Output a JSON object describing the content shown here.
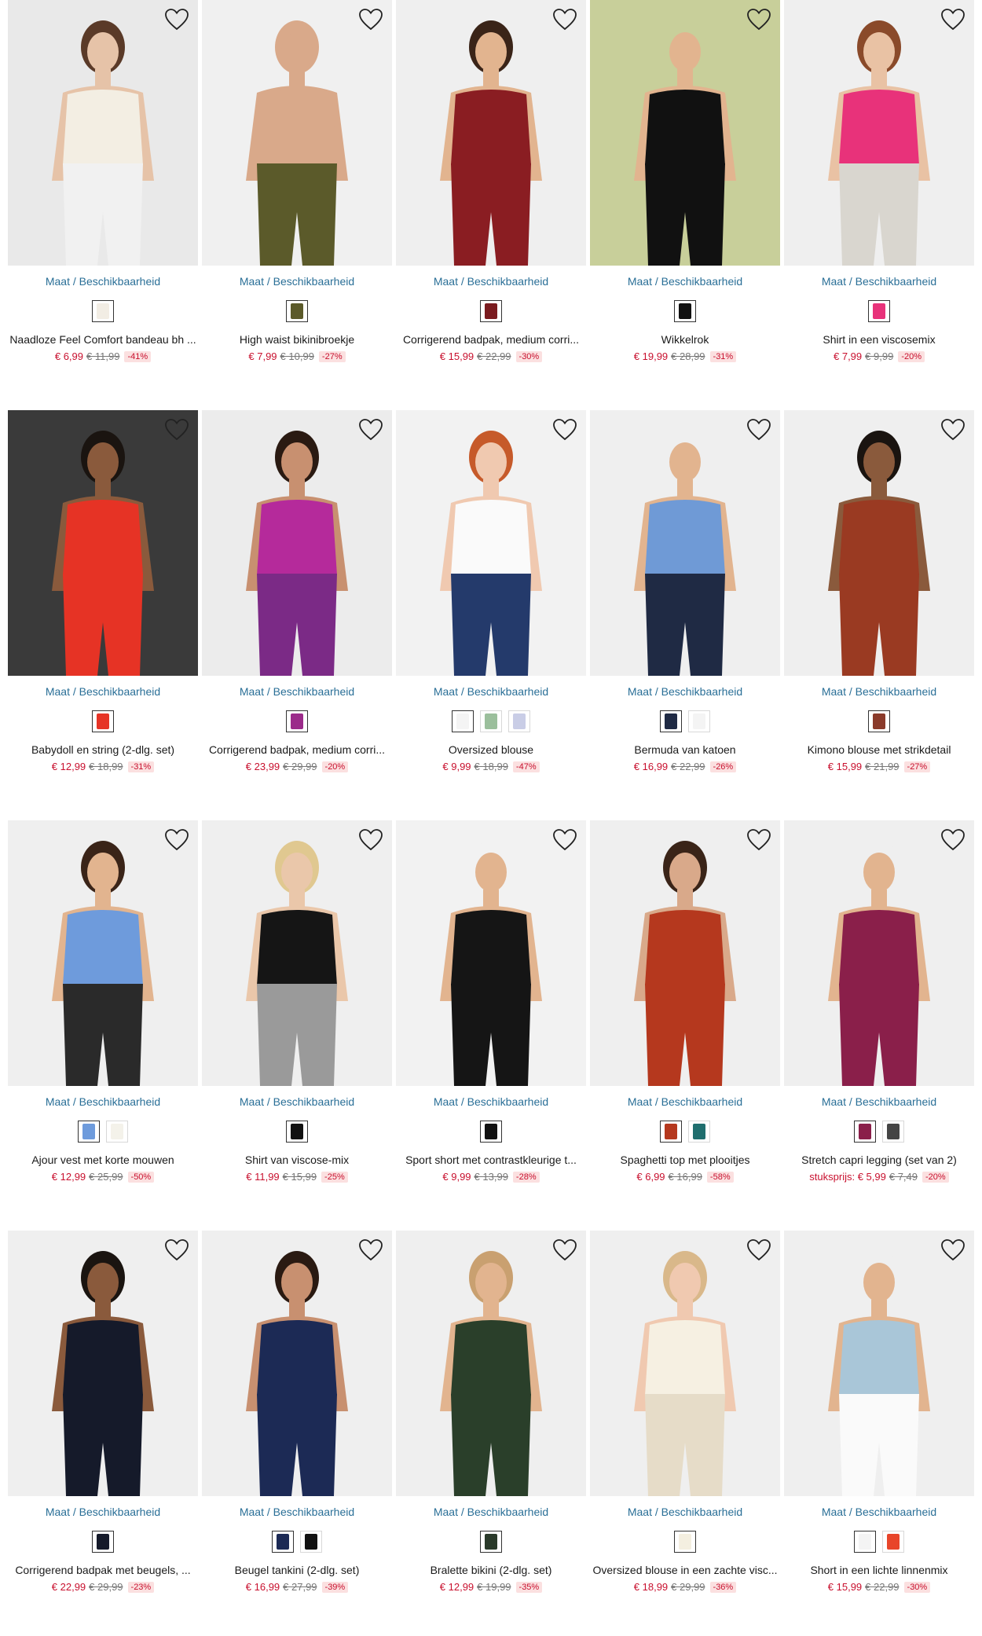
{
  "availability_link": {
    "maat": "Maat",
    "sep": " / ",
    "beschikbaarheid": "Beschikbaarheid"
  },
  "products": [
    {
      "name": "Naadloze Feel Comfort bandeau bh ...",
      "price": "€ 6,99",
      "old_price": "€ 11,99",
      "discount": "-41%",
      "swatches": [
        "#f2ede4"
      ],
      "image": {
        "bg": "#e9e9e9",
        "top": "#f3eee3",
        "bottom": "#f1f1f1",
        "skin": "#e6c3a8",
        "hair": "#5a3a28"
      }
    },
    {
      "name": "High waist bikinibroekje",
      "price": "€ 7,99",
      "old_price": "€ 10,99",
      "discount": "-27%",
      "swatches": [
        "#5b5a2a"
      ],
      "image": {
        "bg": "#f0f0f0",
        "top": "#d9a98a",
        "bottom": "#5b5a2a",
        "skin": "#d9a98a",
        "hair": "#d9a98a"
      }
    },
    {
      "name": "Corrigerend badpak, medium corri...",
      "price": "€ 15,99",
      "old_price": "€ 22,99",
      "discount": "-30%",
      "swatches": [
        "#7a1b1f"
      ],
      "image": {
        "bg": "#efefef",
        "top": "#8a1d22",
        "bottom": "#8a1d22",
        "skin": "#e2b48f",
        "hair": "#3a2418"
      }
    },
    {
      "name": "Wikkelrok",
      "price": "€ 19,99",
      "old_price": "€ 28,99",
      "discount": "-31%",
      "swatches": [
        "#111111"
      ],
      "image": {
        "bg": "#c8cf9a",
        "top": "#111111",
        "bottom": "#111111",
        "skin": "#e2b48f",
        "hair": "#c8cf9a"
      }
    },
    {
      "name": "Shirt in een viscosemix",
      "price": "€ 7,99",
      "old_price": "€ 9,99",
      "discount": "-20%",
      "swatches": [
        "#e8327a"
      ],
      "image": {
        "bg": "#efefef",
        "top": "#e8327a",
        "bottom": "#d9d6cf",
        "skin": "#e9c2a4",
        "hair": "#8a4a2a"
      }
    },
    {
      "name": "Babydoll en string (2-dlg. set)",
      "price": "€ 12,99",
      "old_price": "€ 18,99",
      "discount": "-31%",
      "swatches": [
        "#e63325"
      ],
      "image": {
        "bg": "#3a3a3a",
        "top": "#e63325",
        "bottom": "#e63325",
        "skin": "#8a5a3c",
        "hair": "#1a1410"
      }
    },
    {
      "name": "Corrigerend badpak, medium corri...",
      "price": "€ 23,99",
      "old_price": "€ 29,99",
      "discount": "-20%",
      "swatches": [
        "#9b2a8a"
      ],
      "image": {
        "bg": "#ececec",
        "top": "#b52a9b",
        "bottom": "#7b2a86",
        "skin": "#c89070",
        "hair": "#2a1a12"
      }
    },
    {
      "name": "Oversized blouse",
      "price": "€ 9,99",
      "old_price": "€ 18,99",
      "discount": "-47%",
      "swatches": [
        "#f4f4f4",
        "#9bbf9c",
        "#c9cde6"
      ],
      "image": {
        "bg": "#f2f2f2",
        "top": "#fafafa",
        "bottom": "#243a6b",
        "skin": "#f0c9b0",
        "hair": "#c65a2a"
      }
    },
    {
      "name": "Bermuda van katoen",
      "price": "€ 16,99",
      "old_price": "€ 22,99",
      "discount": "-26%",
      "swatches": [
        "#1f2a44",
        "#f4f4f4"
      ],
      "image": {
        "bg": "#efefef",
        "top": "#6f9ad6",
        "bottom": "#1f2a44",
        "skin": "#e2b48f",
        "hair": "#efefef"
      }
    },
    {
      "name": "Kimono blouse met strikdetail",
      "price": "€ 15,99",
      "old_price": "€ 21,99",
      "discount": "-27%",
      "swatches": [
        "#8a3a2a"
      ],
      "image": {
        "bg": "#efefef",
        "top": "#9a3a22",
        "bottom": "#9a3a22",
        "skin": "#8a5a3c",
        "hair": "#1a1410"
      }
    },
    {
      "name": "Ajour vest met korte mouwen",
      "price": "€ 12,99",
      "old_price": "€ 25,99",
      "discount": "-50%",
      "swatches": [
        "#6e9bdc",
        "#f4f2ea"
      ],
      "image": {
        "bg": "#efefef",
        "top": "#6e9bdc",
        "bottom": "#2a2a2a",
        "skin": "#e2b48f",
        "hair": "#3a2418"
      }
    },
    {
      "name": "Shirt van viscose-mix",
      "price": "€ 11,99",
      "old_price": "€ 15,99",
      "discount": "-25%",
      "swatches": [
        "#111111"
      ],
      "image": {
        "bg": "#efefef",
        "top": "#151515",
        "bottom": "#9a9a9a",
        "skin": "#eac7aa",
        "hair": "#e0c890"
      }
    },
    {
      "name": "Sport short met contrastkleurige t...",
      "price": "€ 9,99",
      "old_price": "€ 13,99",
      "discount": "-28%",
      "swatches": [
        "#111111"
      ],
      "image": {
        "bg": "#f2f2f2",
        "top": "#151515",
        "bottom": "#151515",
        "skin": "#e2b48f",
        "hair": "#f2f2f2"
      }
    },
    {
      "name": "Spaghetti top met plooitjes",
      "price": "€ 6,99",
      "old_price": "€ 16,99",
      "discount": "-58%",
      "swatches": [
        "#b5381e",
        "#1f6e6e"
      ],
      "image": {
        "bg": "#efefef",
        "top": "#b5381e",
        "bottom": "#b5381e",
        "skin": "#d9a98a",
        "hair": "#3a2418"
      }
    },
    {
      "name": "Stretch capri legging (set van 2)",
      "unit_label": "stuksprijs: ",
      "price": "€ 5,99",
      "old_price": "€ 7,49",
      "discount": "-20%",
      "swatches": [
        "#8a1f4a",
        "#444444"
      ],
      "image": {
        "bg": "#efefef",
        "top": "#8a1f4a",
        "bottom": "#8a1f4a",
        "skin": "#e2b48f",
        "hair": "#efefef"
      }
    },
    {
      "name": "Corrigerend badpak met beugels, ...",
      "price": "€ 22,99",
      "old_price": "€ 29,99",
      "discount": "-23%",
      "swatches": [
        "#151a2a"
      ],
      "image": {
        "bg": "#efefef",
        "top": "#151a2a",
        "bottom": "#151a2a",
        "skin": "#8a5a3c",
        "hair": "#1a1410"
      }
    },
    {
      "name": "Beugel tankini (2-dlg. set)",
      "price": "€ 16,99",
      "old_price": "€ 27,99",
      "discount": "-39%",
      "swatches": [
        "#1c2a55",
        "#111111"
      ],
      "image": {
        "bg": "#efefef",
        "top": "#1c2a55",
        "bottom": "#1c2a55",
        "skin": "#c89070",
        "hair": "#2a1a12"
      }
    },
    {
      "name": "Bralette bikini (2-dlg. set)",
      "price": "€ 12,99",
      "old_price": "€ 19,99",
      "discount": "-35%",
      "swatches": [
        "#2a3a2a"
      ],
      "image": {
        "bg": "#efefef",
        "top": "#2a3f2a",
        "bottom": "#2a3f2a",
        "skin": "#e2b48f",
        "hair": "#c9a070"
      }
    },
    {
      "name": "Oversized blouse in een zachte visc...",
      "price": "€ 18,99",
      "old_price": "€ 29,99",
      "discount": "-36%",
      "swatches": [
        "#f4efe0"
      ],
      "image": {
        "bg": "#efefef",
        "top": "#f6f0e2",
        "bottom": "#e6dcc8",
        "skin": "#f0c9b0",
        "hair": "#d9b88a"
      }
    },
    {
      "name": "Short in een lichte linnenmix",
      "price": "€ 15,99",
      "old_price": "€ 22,99",
      "discount": "-30%",
      "swatches": [
        "#f4f4f4",
        "#e8452a"
      ],
      "image": {
        "bg": "#efefef",
        "top": "#a9c6d8",
        "bottom": "#fafafa",
        "skin": "#e2b48f",
        "hair": "#efefef"
      }
    }
  ]
}
